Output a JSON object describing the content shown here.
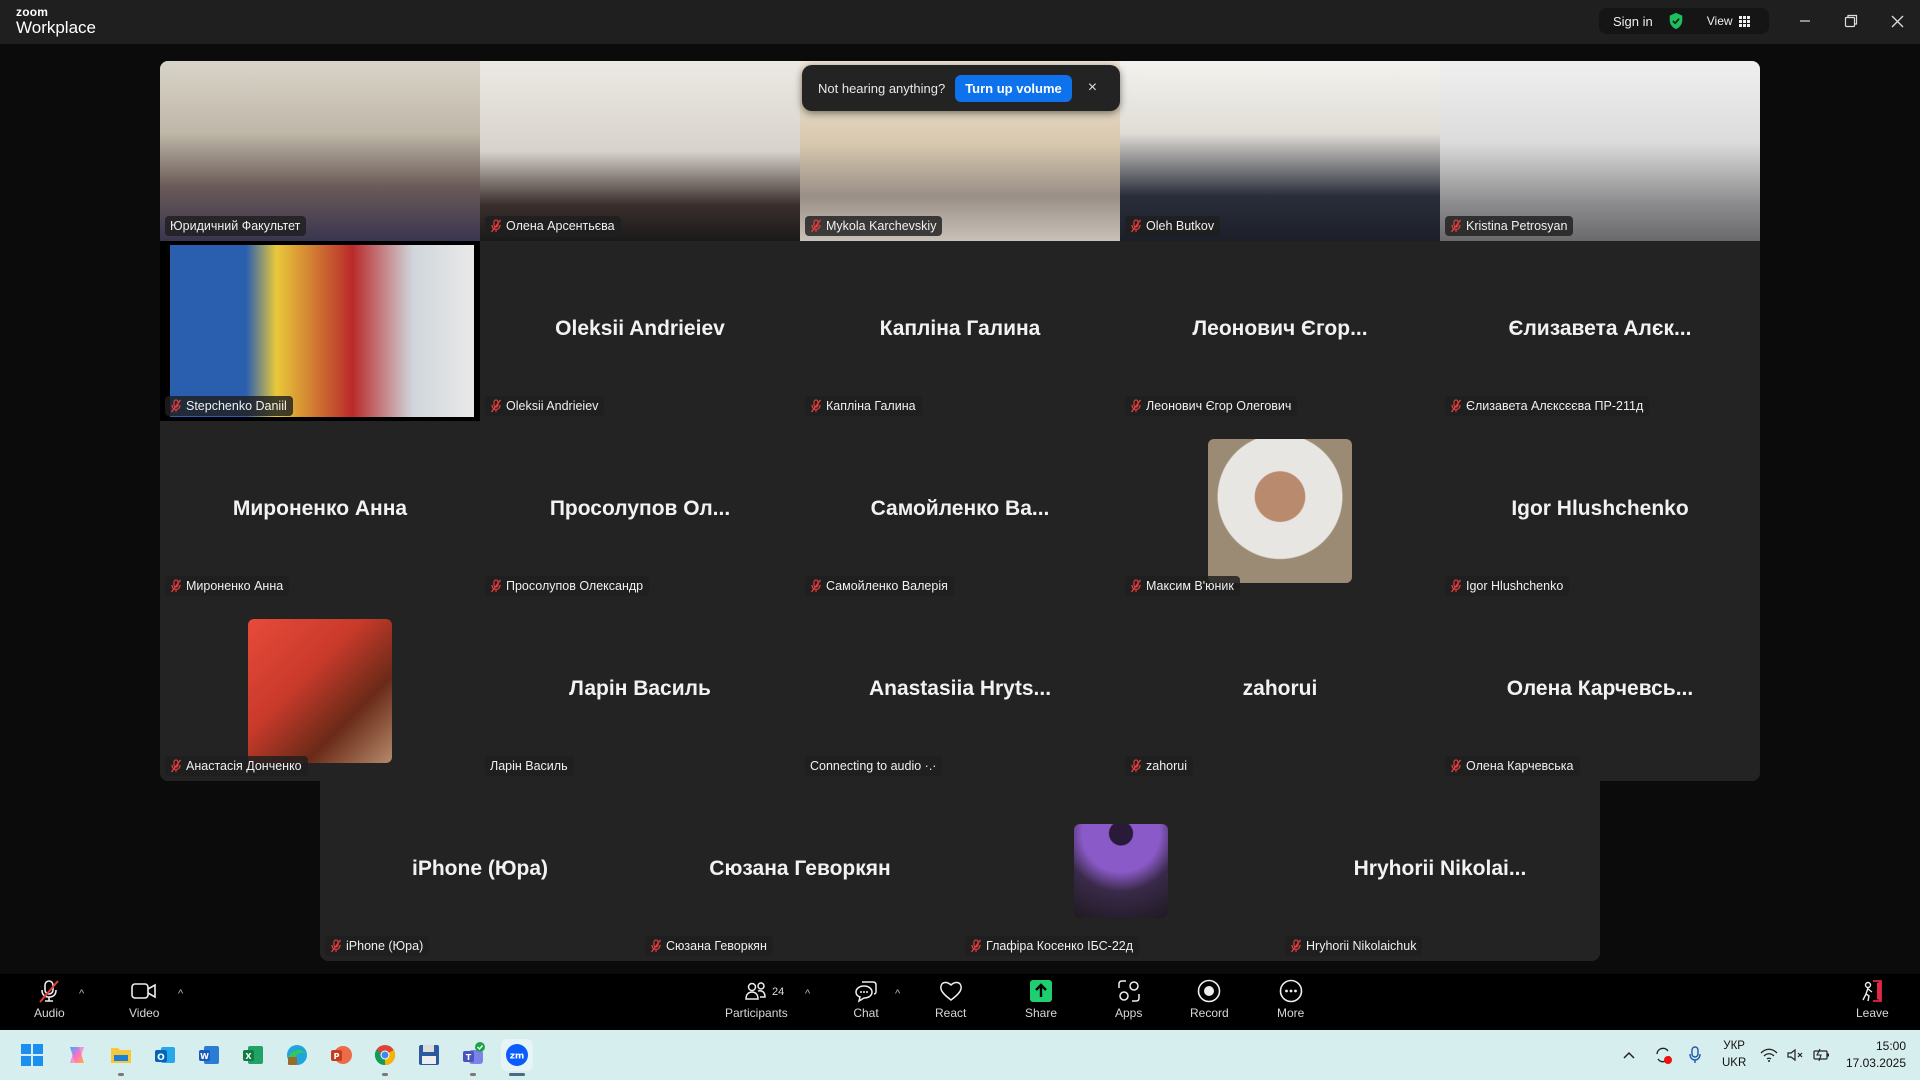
{
  "app": {
    "brand_small": "zoom",
    "brand_large": "Workplace"
  },
  "titlebar": {
    "sign_in": "Sign in",
    "view": "View",
    "security_icon": "shield-check-icon"
  },
  "notification": {
    "message": "Not hearing anything?",
    "action": "Turn up volume",
    "close": "×"
  },
  "colors": {
    "accent": "#0e72ed",
    "active_speaker": "#2fd48c",
    "muted": "#e03e3e",
    "share": "#1fcf6f",
    "leave": "#e02848"
  },
  "participants": [
    {
      "display": "",
      "label": "Юридичний Факультет",
      "muted": false,
      "video": "video-yuryd",
      "active": true
    },
    {
      "display": "",
      "label": "Олена Арсентьєва",
      "muted": true,
      "video": "video-olena"
    },
    {
      "display": "",
      "label": "Mykola Karchevskiy",
      "muted": true,
      "video": "video-mykola"
    },
    {
      "display": "",
      "label": "Oleh Butkov",
      "muted": true,
      "video": "video-oleh"
    },
    {
      "display": "",
      "label": "Kristina Petrosyan",
      "muted": true,
      "video": "video-kristina"
    },
    {
      "display": "",
      "label": "Stepchenko Daniil",
      "muted": true,
      "video": "video-stepchenko"
    },
    {
      "display": "Oleksii Andrieiev",
      "label": "Oleksii Andrieiev",
      "muted": true
    },
    {
      "display": "Капліна Галина",
      "label": "Капліна Галина",
      "muted": true
    },
    {
      "display": "Леонович Єгор...",
      "label": "Леонович Єгор Олегович",
      "muted": true
    },
    {
      "display": "Єлизавета Алєк...",
      "label": "Єлизавета Алєксєєва ПР-211д",
      "muted": true
    },
    {
      "display": "Мироненко Анна",
      "label": "Мироненко Анна",
      "muted": true
    },
    {
      "display": "Просолупов Ол...",
      "label": "Просолупов Олександр",
      "muted": true
    },
    {
      "display": "Самойленко Ва...",
      "label": "Самойленко Валерія",
      "muted": true
    },
    {
      "display": "",
      "label": "Максим В'юник",
      "muted": true,
      "avatar": "photo"
    },
    {
      "display": "Igor Hlushchenko",
      "label": "Igor Hlushchenko",
      "muted": true
    },
    {
      "display": "",
      "label": "Анастасія Донченко",
      "muted": true,
      "avatar": "red-photo"
    },
    {
      "display": "Ларін Василь",
      "label": "Ларін Василь",
      "muted": false
    },
    {
      "display": "Anastasiia Hryts...",
      "label": "Connecting to audio ·.·",
      "muted": false
    },
    {
      "display": "zahorui",
      "label": "zahorui",
      "muted": true
    },
    {
      "display": "Олена Карчевсь...",
      "label": "Олена Карчевська",
      "muted": true
    },
    {
      "display": "iPhone (Юра)",
      "label": "iPhone (Юра)",
      "muted": true
    },
    {
      "display": "Сюзана Геворкян",
      "label": "Сюзана Геворкян",
      "muted": true
    },
    {
      "display": "",
      "label": "Глафіра Косенко ІБС-22д",
      "muted": true,
      "avatar": "purple-art"
    },
    {
      "display": "Hryhorii Nikolai...",
      "label": "Hryhorii Nikolaichuk",
      "muted": true
    }
  ],
  "toolbar": {
    "audio": "Audio",
    "video": "Video",
    "participants": "Participants",
    "participants_count": "24",
    "chat": "Chat",
    "react": "React",
    "share": "Share",
    "apps": "Apps",
    "record": "Record",
    "more": "More",
    "leave": "Leave"
  },
  "taskbar": {
    "apps": [
      "start",
      "copilot",
      "file-explorer",
      "outlook",
      "word",
      "excel",
      "edge",
      "powerpoint",
      "chrome",
      "save-app",
      "teams",
      "zoom"
    ],
    "lang_top": "УКР",
    "lang_bottom": "UKR",
    "time": "15:00",
    "date": "17.03.2025"
  }
}
